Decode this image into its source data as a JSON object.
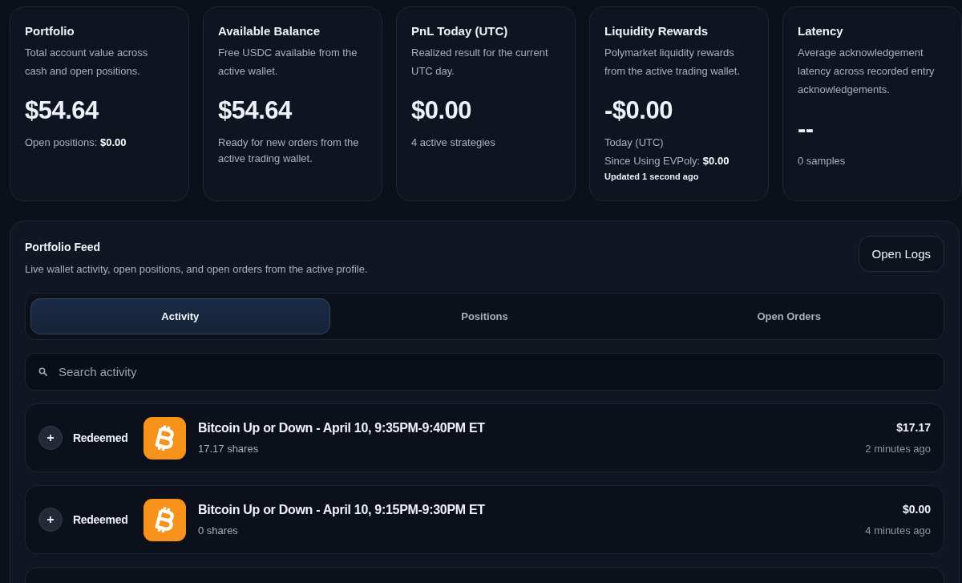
{
  "cards": [
    {
      "title": "Portfolio",
      "description": "Total account value across cash and open positions.",
      "value": "$54.64",
      "notes": [
        {
          "kind": "note",
          "text": "Open positions: **$0.00**"
        }
      ]
    },
    {
      "title": "Available Balance",
      "description": "Free USDC available from the active wallet.",
      "value": "$54.64",
      "notes": [
        {
          "kind": "note",
          "text": "Ready for new orders from the active trading wallet."
        }
      ]
    },
    {
      "title": "PnL Today (UTC)",
      "description": "Realized result for the current UTC day.",
      "value": "$0.00",
      "notes": [
        {
          "kind": "note",
          "text": "4 active strategies"
        }
      ]
    },
    {
      "title": "Liquidity Rewards",
      "description": "Polymarket liquidity rewards from the active trading wallet.",
      "value": "-$0.00",
      "notes": [
        {
          "kind": "note",
          "text": "Today (UTC)"
        },
        {
          "kind": "note",
          "text": "Since Using EVPoly: **$0.00**"
        },
        {
          "kind": "updated",
          "text": "Updated 1 second ago"
        }
      ]
    },
    {
      "title": "Latency",
      "description": "Average acknowledgement latency across recorded entry acknowledgements.",
      "value": "--",
      "notes": [
        {
          "kind": "note",
          "text": "0 samples"
        }
      ]
    }
  ],
  "feed": {
    "title": "Portfolio Feed",
    "description": "Live wallet activity, open positions, and open orders from the active profile.",
    "open_logs": "Open Logs",
    "tabs": [
      {
        "label": "Activity",
        "selected": true
      },
      {
        "label": "Positions",
        "selected": false
      },
      {
        "label": "Open Orders",
        "selected": false
      }
    ],
    "search": {
      "placeholder": "Search activity"
    },
    "rows": [
      {
        "action": "Redeemed",
        "market": "Bitcoin Up or Down - April 10, 9:35PM-9:40PM ET",
        "shares": "17.17 shares",
        "amount": "$17.17",
        "time": "2 minutes ago"
      },
      {
        "action": "Redeemed",
        "market": "Bitcoin Up or Down - April 10, 9:15PM-9:30PM ET",
        "shares": "0 shares",
        "amount": "$0.00",
        "time": "4 minutes ago"
      }
    ]
  }
}
